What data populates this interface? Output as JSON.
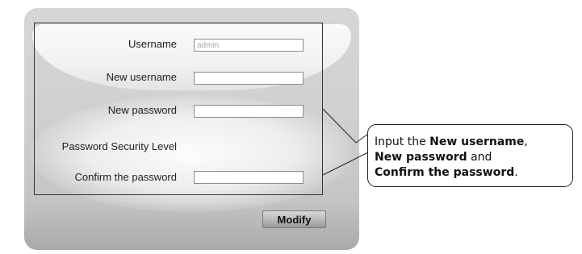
{
  "form": {
    "username_label": "Username",
    "username_value": "admin",
    "new_username_label": "New username",
    "new_password_label": "New password",
    "security_level_label": "Password Security Level",
    "confirm_password_label": "Confirm the password",
    "modify_button": "Modify"
  },
  "callout": {
    "prefix": "Input the ",
    "new_username": "New username",
    "sep1": ",",
    "new_password": "New password",
    "sep2": " and",
    "confirm_password": "Confirm the password",
    "end": "."
  }
}
